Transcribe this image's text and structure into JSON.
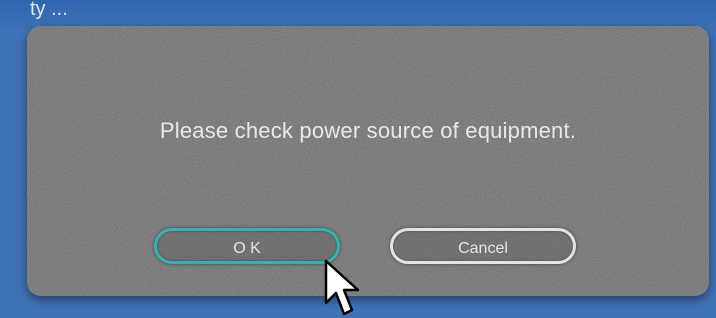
{
  "background": {
    "top_text": "ty ...",
    "color": "#3f73b8"
  },
  "dialog": {
    "message": "Please check power source of equipment.",
    "ok_label": "O K",
    "cancel_label": "Cancel",
    "ok_border_color": "#2fb6b0",
    "cancel_border_color": "#e3e3e3",
    "panel_color": "#6a6a6a"
  },
  "cursor": {
    "icon": "arrow-pointer-icon"
  }
}
